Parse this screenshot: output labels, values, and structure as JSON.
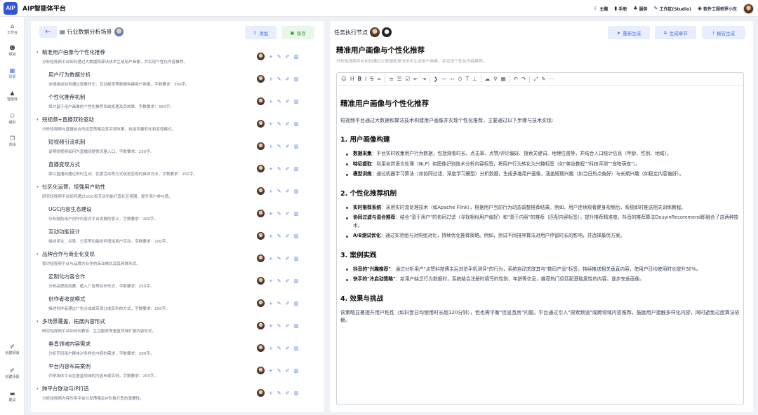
{
  "app": {
    "logo": "AIP",
    "title": "AIP智能体平台"
  },
  "topbar": [
    {
      "icon": "moon-icon",
      "glyph": "☾",
      "label": "主题"
    },
    {
      "icon": "book-icon",
      "glyph": "▮",
      "label": "手册"
    },
    {
      "icon": "service-icon",
      "glyph": "♣",
      "label": "服务"
    },
    {
      "icon": "workspace-icon",
      "glyph": "✎",
      "label": "工作区(Studio)"
    },
    {
      "icon": "shield-icon",
      "glyph": "◉",
      "label": "软件工程师罗小东"
    }
  ],
  "sidebar": [
    {
      "icon": "home-icon",
      "glyph": "⌂",
      "label": "工作台"
    },
    {
      "icon": "users-icon",
      "glyph": "☻",
      "label": "频道"
    },
    {
      "icon": "scene-icon",
      "glyph": "▦",
      "label": "场景",
      "active": true
    },
    {
      "icon": "agent-icon",
      "glyph": "▲",
      "label": "智能体"
    },
    {
      "icon": "org-icon",
      "glyph": "⚇",
      "label": "组织"
    },
    {
      "icon": "market-icon",
      "glyph": "❐",
      "label": "市场"
    },
    {
      "icon": "create-channel-icon",
      "glyph": "✐",
      "label": "创建频道"
    },
    {
      "icon": "create-scene-icon",
      "glyph": "✐",
      "label": "创建场景"
    },
    {
      "icon": "suggest-icon",
      "glyph": "▬",
      "label": "建议"
    }
  ],
  "left": {
    "back": "←",
    "scene_title": "行业数据分析场景",
    "add": "添加",
    "save": "保存"
  },
  "tree": [
    {
      "level": 0,
      "title": "精准用户画像与个性化推荐",
      "desc": "分析短视频平台如何通过大数据和算法技术生成用户画像，并实现个性化内容推荐。"
    },
    {
      "level": 1,
      "title": "用户行为数据分析",
      "desc": "详细描述如何通过观看时长、互动频率等数据构建用户画像，字数要求：300字。"
    },
    {
      "level": 1,
      "title": "个性化推荐机制",
      "desc": "探讨基于用户画像的个性化推荐系统原理及其效果，字数要求：300字。"
    },
    {
      "level": 0,
      "title": "短视频+直播双轮驱动",
      "desc": "分析短视频与直播结合的运营策略及其实现效果，包括流量转化和变现模式。"
    },
    {
      "level": 1,
      "title": "短视频引流机制",
      "desc": "说明短视频如何为直播间提供流量入口，字数要求：250字。"
    },
    {
      "level": 1,
      "title": "直播变现方式",
      "desc": "探讨直播间通过即时互动、优惠活动等方式促进变现的具体方法，字数要求：250字。"
    },
    {
      "level": 0,
      "title": "社区化运营，增强用户粘性",
      "desc": "研究短视频平台如何通过UGC和互动功能打造社区氛围，提升用户参与感。"
    },
    {
      "level": 1,
      "title": "UGC内容生态建设",
      "desc": "分析鼓励用户创作内容对平台发展的意义，字数要求：200字。"
    },
    {
      "level": 1,
      "title": "互动功能设计",
      "desc": "描述评论、点赞、分享等功能如何增加用户互动，字数要求：200字。"
    },
    {
      "level": 0,
      "title": "品牌合作与商业化变现",
      "desc": "探讨短视频平台与品牌方合作的商业模式及其具体形式。"
    },
    {
      "level": 1,
      "title": "定制化内容合作",
      "desc": "分析品牌挑战赛、植入广告等合作形式，字数要求：250字。"
    },
    {
      "level": 1,
      "title": "创作者收益模式",
      "desc": "描述创作者通过广告分成或带货分成获利的方式，字数要求：250字。"
    },
    {
      "level": 0,
      "title": "多场景覆盖，拓展内容形式",
      "desc": "研究短视频平台如何向教育、生活服务等垂直领域扩展内容形式。"
    },
    {
      "level": 1,
      "title": "垂直领域内容需求",
      "desc": "分析不同用户群体对多样化内容的需求，字数要求：200字。"
    },
    {
      "level": 1,
      "title": "平台内容布局案例",
      "desc": "列举具体平台在垂直领域的内容布局实例，字数要求：200字。"
    },
    {
      "level": 0,
      "title": "跨平台联动与IP打造",
      "desc": "分析短视频内容的多平台分发策略及IP形象打造的重要性。"
    }
  ],
  "right": {
    "task_label": "任务执行节点",
    "regen": "重新生成",
    "gen_chapter": "生成章节",
    "report_gen": "报告生成",
    "doc_title": "精准用户画像与个性化推荐",
    "doc_sub": "分析短视频平台如何通过大数据和算法技术生成用户画像，并实现个性化内容推荐。"
  },
  "doc": {
    "h1": "精准用户画像与个性化推荐",
    "intro": "短视频平台通过大数据和算法技术构建用户画像并实现个性化推荐，主要通过以下步骤与技术实现:",
    "s1": "1. 用户画像构建",
    "s1_items": [
      {
        "k": "数据采集",
        "v": "：平台实时收集用户行为数据，包括观看时长、点击率、点赞/评论偏好、搜索关键词、地理位置等，并结合人口统计信息（年龄、性别、地域）。"
      },
      {
        "k": "特征提取",
        "v": "：利用自然语言处理（NLP）和图像识别技术分析内容标签，将用户行为转化为兴趣标签（如\"美妆教程\"\"科技评测\"\"宠物萌宠\"）。"
      },
      {
        "k": "模型训练",
        "v": "：通过机器学习算法（如协同过滤、深度学习模型）分析数据，生成多维用户画像，涵盖短期兴趣（如当日热点偏好）与长期兴趣（如稳定内容偏好）。"
      }
    ],
    "s2": "2. 个性化推荐机制",
    "s2_items": [
      {
        "k": "实时推荐系统",
        "v": "：采用实时流处理技术（如Apache Flink），根据用户当前行为动态调整推荐结果。例如，用户连续观看健身视频后，系统即时推送相关训练教程。"
      },
      {
        "k": "协同过滤与混合推荐",
        "v": "：结合\"基于用户\"的协同过滤（寻找相似用户偏好）和\"基于内容\"的推荐（匹配内容标签），提升推荐精准度。抖音的推荐算法DouyinRecommend即融合了这两种技术。"
      },
      {
        "k": "A/B测试优化",
        "v": "：通过实验组与对照组对比，持续优化推荐策略。例如，测试不同排序算法对用户停留时长的影响，并选择最优方案。"
      }
    ],
    "s3": "3. 案例实践",
    "s3_items": [
      {
        "k": "抖音的\"兴趣推荐\"",
        "v": "：通过分析用户\"点赞科技博主后浏览手机测评\"的行为，系统自动关联其与\"数码产品\"标签，持续推送相关垂直内容，使用户日均使用时长提升30%。"
      },
      {
        "k": "快手的\"冷启动策略\"",
        "v": "：新用户缺乏行为数据时，系统结合注册时填写的性别、年龄等信息，推荐热门但匹配基础属性的内容，逐步完善画像。"
      }
    ],
    "s4": "4. 效果与挑战",
    "s4_text": "该策略显著提升用户粘性（如抖音日均使用时长超120分钟），但也需平衡\"信息茧房\"问题。平台通过引入\"探索频道\"或跨领域内容推荐，鼓励用户接触多样化内容，同时避免过度算法依赖。"
  }
}
